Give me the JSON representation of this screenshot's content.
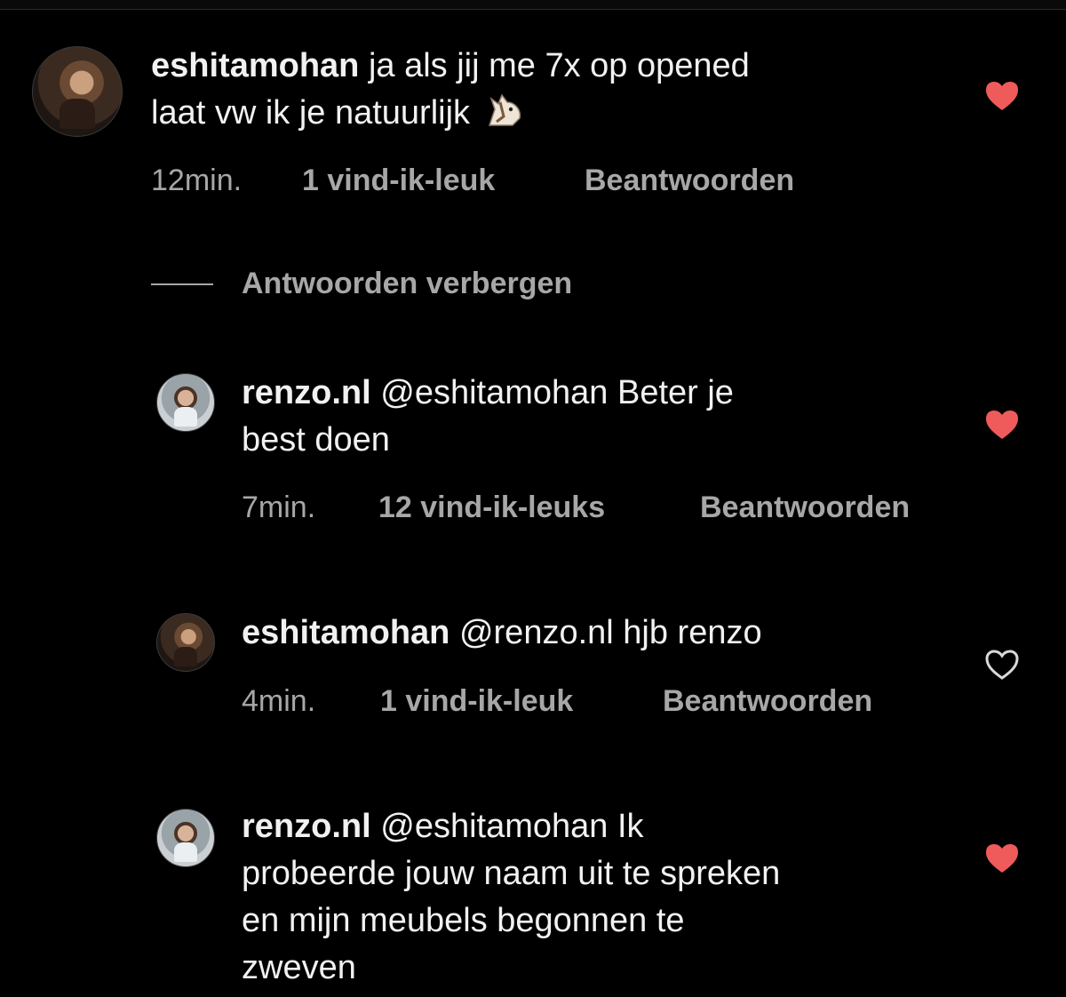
{
  "colors": {
    "background": "#000000",
    "text": "#f1f1f1",
    "meta_text": "#a7a7a7",
    "heart_filled": "#ef5b5b",
    "heart_outline": "#d9d9d9"
  },
  "comments": [
    {
      "username": "eshitamohan",
      "line1": "ja als jij me 7x op opened",
      "line2": "laat vw ik je natuurlijk",
      "emoji_icon": "horse-face-icon",
      "time": "12min.",
      "likes": "1 vind-ik-leuk",
      "reply_label": "Beantwoorden",
      "liked": true
    },
    {
      "username": "renzo.nl",
      "line1": "@eshitamohan Beter je",
      "line2": "best doen",
      "time": "7min.",
      "likes": "12 vind-ik-leuks",
      "reply_label": "Beantwoorden",
      "liked": true
    },
    {
      "username": "eshitamohan",
      "line1": "@renzo.nl hjb renzo",
      "time": "4min.",
      "likes": "1 vind-ik-leuk",
      "reply_label": "Beantwoorden",
      "liked": false
    },
    {
      "username": "renzo.nl",
      "line1": "@eshitamohan Ik",
      "line2": "probeerde jouw naam uit te spreken",
      "line3": "en mijn meubels begonnen te",
      "line4": "zweven",
      "liked": true
    }
  ],
  "hide_replies_label": "Antwoorden verbergen"
}
